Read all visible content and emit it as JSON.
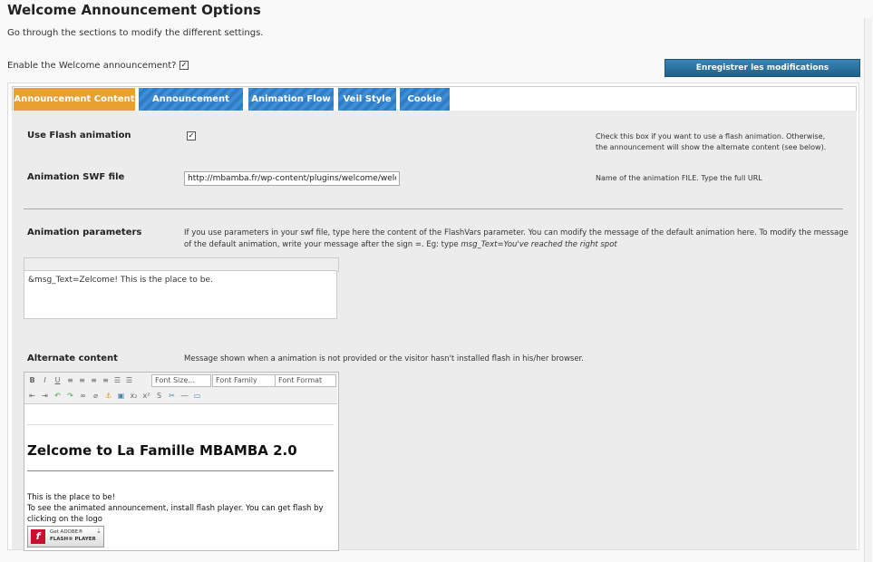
{
  "page": {
    "title": "Welcome Announcement Options",
    "subtitle": "Go through the sections to modify the different settings.",
    "enable_label": "Enable the Welcome announcement?",
    "enable_checked": true,
    "save_button": "Enregistrer les modifications"
  },
  "tabs": [
    {
      "label": "Announcement Content",
      "active": true
    },
    {
      "label": "Announcement Style",
      "active": false
    },
    {
      "label": "Animation Flow",
      "active": false
    },
    {
      "label": "Veil Style",
      "active": false
    },
    {
      "label": "Cookie",
      "active": false
    }
  ],
  "fields": {
    "flash": {
      "label": "Use Flash animation",
      "checked": true,
      "help": "Check this box if you want to use a flash animation. Otherwise, the announcement will show the alternate content (see below)."
    },
    "swf": {
      "label": "Animation SWF file",
      "value": "http://mbamba.fr/wp-content/plugins/welcome/welcome.swf",
      "help": "Name of the animation FILE. Type the full URL"
    },
    "params": {
      "label": "Animation parameters",
      "help_main": "If you use parameters in your swf file, type here the content of the FlashVars parameter. You can modify the message of the default animation here. To modify the message of the default animation, write your message after the sign =. Eg: type ",
      "help_example": "msg_Text=You've reached the right spot",
      "value": "&msg_Text=Zelcome! This is the place to be."
    },
    "alternate": {
      "label": "Alternate content",
      "help": "Message shown when a animation is not provided or the visitor hasn't installed flash in his/her browser.",
      "toolbar": {
        "font_size": "Font Size...",
        "font_family": "Font Family",
        "font_format": "Font Format"
      },
      "heading": "Zelcome to La Famille MBAMBA 2.0",
      "line1": "This is the place to be!",
      "line2": "To see the animated announcement, install flash player. You can get flash by clicking on the logo",
      "flash_badge": {
        "get": "Get ADOBE®",
        "player": "FLASH® PLAYER"
      }
    }
  }
}
